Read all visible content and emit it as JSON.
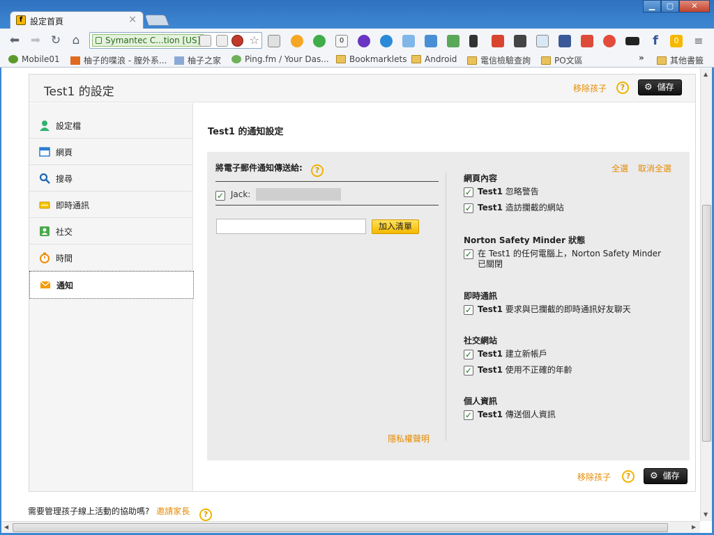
{
  "browser": {
    "tab_title": "設定首頁",
    "tab_close": "×",
    "omnibox_text": "Symantec C...tion [US]",
    "window_buttons": [
      "▁",
      "▢",
      "✕"
    ],
    "extension_badges": [
      "0",
      "0"
    ],
    "bookmarks": [
      {
        "label": "Mobile01",
        "icon": "site-icon"
      },
      {
        "label": "柚子的喋浪 - 膣外系...",
        "icon": "site-icon"
      },
      {
        "label": "柚子之家",
        "icon": "site-icon"
      },
      {
        "label": "Ping.fm / Your Das...",
        "icon": "site-icon"
      },
      {
        "label": "Bookmarklets",
        "icon": "folder-icon"
      },
      {
        "label": "Android",
        "icon": "folder-icon"
      },
      {
        "label": "電信檢驗查詢",
        "icon": "folder-icon"
      },
      {
        "label": "PO文區",
        "icon": "folder-icon"
      }
    ],
    "bookmarks_more": "»",
    "other_bookmarks": "其他書籤"
  },
  "header": {
    "title": "Test1 的設定",
    "remove_child": "移除孩子",
    "help": "?",
    "save": "儲存"
  },
  "sidebar": {
    "items": [
      {
        "label": "設定檔",
        "icon": "person-icon"
      },
      {
        "label": "網頁",
        "icon": "web-icon"
      },
      {
        "label": "搜尋",
        "icon": "search-icon"
      },
      {
        "label": "即時通訊",
        "icon": "chat-icon"
      },
      {
        "label": "社交",
        "icon": "social-icon"
      },
      {
        "label": "時間",
        "icon": "clock-icon"
      },
      {
        "label": "通知",
        "icon": "mail-icon"
      }
    ],
    "active_index": 6
  },
  "main": {
    "title": "Test1 的通知設定",
    "email_section": {
      "heading": "將電子郵件通知傳送給:",
      "recipient_label": "Jack:",
      "input_placeholder": "",
      "add_button": "加入清單",
      "privacy_link": "隱私權聲明"
    },
    "options": {
      "select_all": "全選",
      "deselect_all": "取消全選",
      "groups": [
        {
          "title": "網頁內容",
          "items": [
            {
              "bold": "Test1",
              "text": " 忽略警告",
              "checked": true
            },
            {
              "bold": "Test1",
              "text": " 造訪攔截的網站",
              "checked": true
            }
          ]
        },
        {
          "title": "Norton Safety Minder 狀態",
          "items": [
            {
              "bold": "",
              "text": "在 Test1 的任何電腦上，Norton Safety Minder 已關閉",
              "checked": true
            }
          ]
        },
        {
          "title": "即時通訊",
          "items": [
            {
              "bold": "Test1",
              "text": " 要求與已攔截的即時通訊好友聊天",
              "checked": true
            }
          ]
        },
        {
          "title": "社交網站",
          "items": [
            {
              "bold": "Test1",
              "text": " 建立新帳戶",
              "checked": true
            },
            {
              "bold": "Test1",
              "text": " 使用不正確的年齡",
              "checked": true
            }
          ]
        },
        {
          "title": "個人資訊",
          "items": [
            {
              "bold": "Test1",
              "text": " 傳送個人資訊",
              "checked": true
            }
          ]
        }
      ]
    }
  },
  "footer": {
    "remove_child": "移除孩子",
    "help": "?",
    "save": "儲存",
    "help_question": "需要管理孩子線上活動的協助嗎?",
    "invite_parent": "邀請家長"
  },
  "colors": {
    "accent_orange": "#e58b00",
    "check_green": "#1a7a1a",
    "save_black": "#111111",
    "add_yellow": "#f5b800"
  }
}
